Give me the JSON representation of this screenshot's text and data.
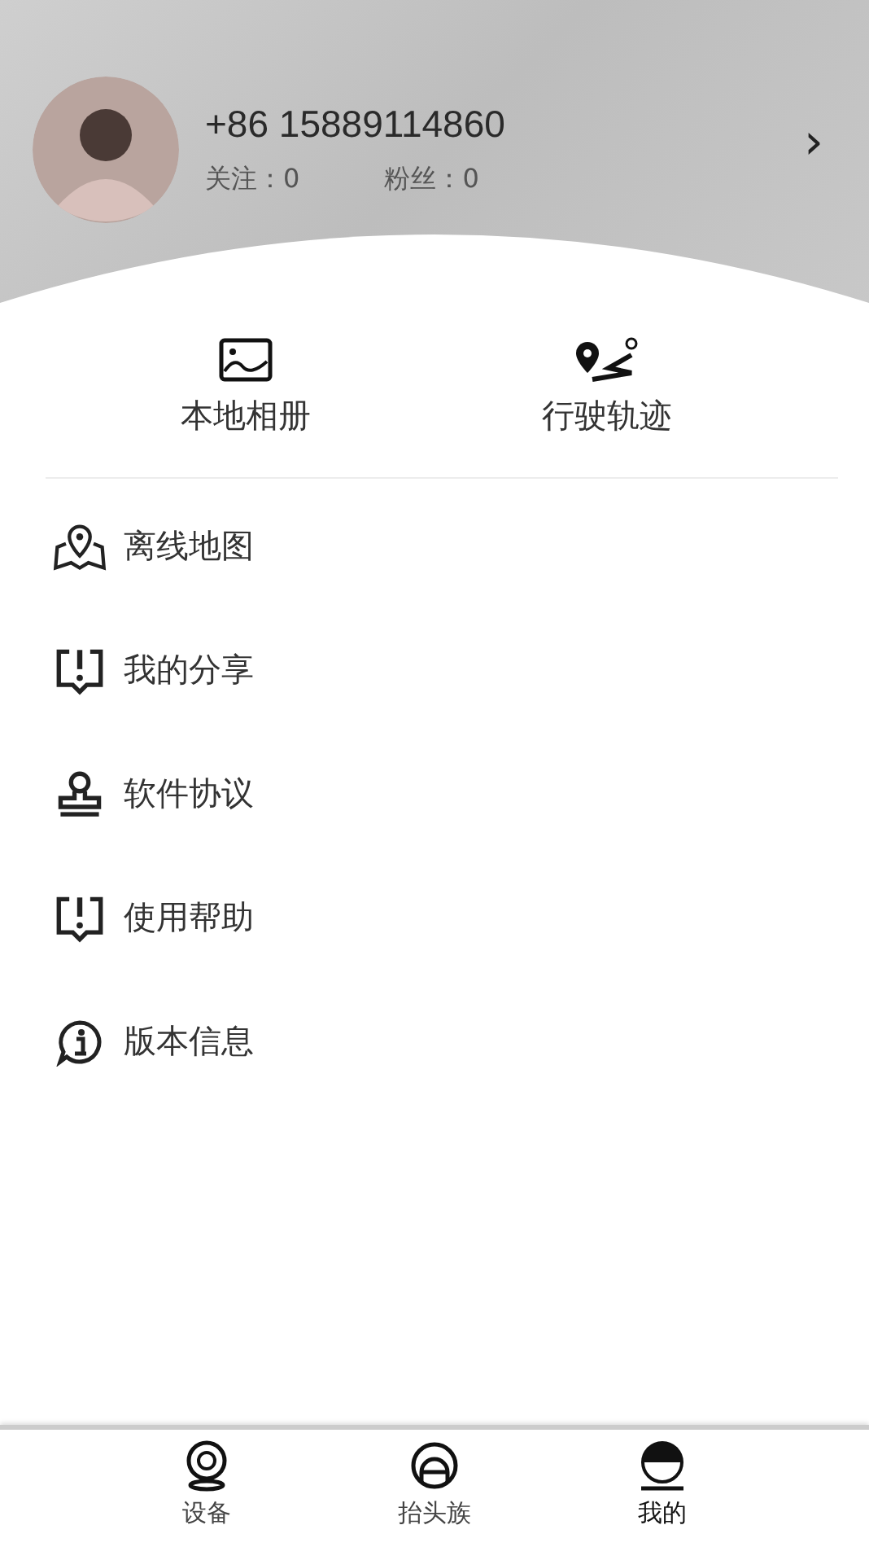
{
  "profile": {
    "phone": "+86 15889114860",
    "following": "关注：0",
    "followers": "粉丝：0",
    "chevron": "›"
  },
  "shortcuts": [
    {
      "kind": "album",
      "label": "本地相册"
    },
    {
      "kind": "track",
      "label": "行驶轨迹"
    }
  ],
  "menu": [
    {
      "kind": "map",
      "label": "离线地图"
    },
    {
      "kind": "notice",
      "label": "我的分享"
    },
    {
      "kind": "stamp",
      "label": "软件协议"
    },
    {
      "kind": "notice",
      "label": "使用帮助"
    },
    {
      "kind": "info",
      "label": "版本信息"
    }
  ],
  "tabs": [
    {
      "kind": "device",
      "label": "设备",
      "selected": false
    },
    {
      "kind": "helmet",
      "label": "抬头族",
      "selected": false
    },
    {
      "kind": "me",
      "label": "我的",
      "selected": true
    }
  ]
}
